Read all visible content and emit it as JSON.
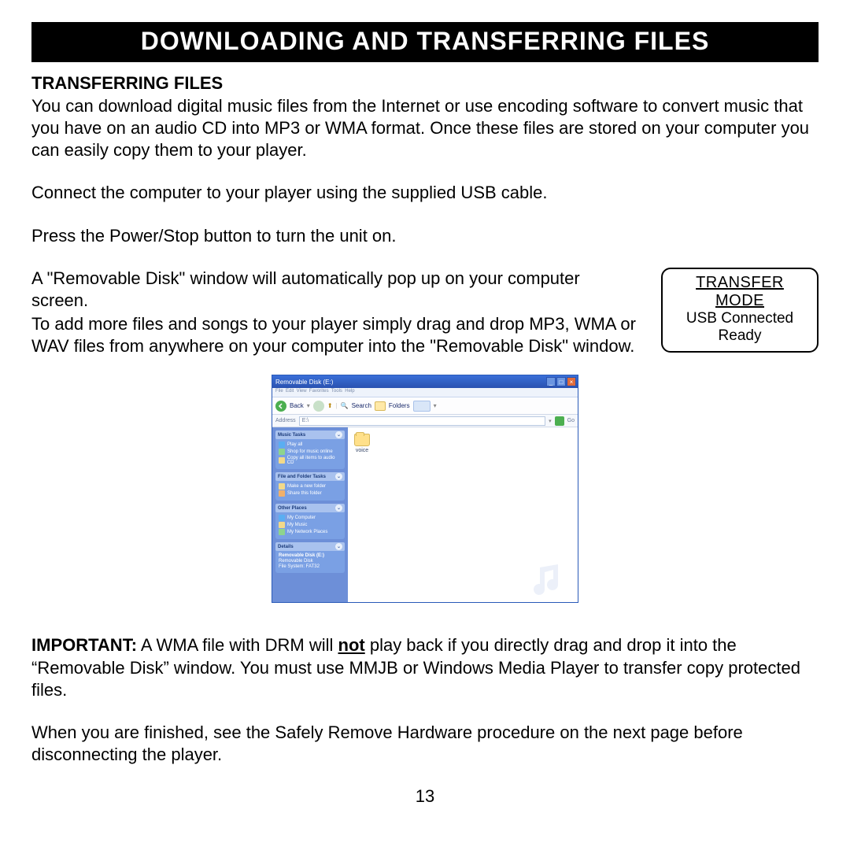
{
  "title": "DOWNLOADING AND TRANSFERRING FILES",
  "subheading": "TRANSFERRING FILES",
  "intro": "You can download digital music files from the Internet or use encoding software to convert music that you have on an audio CD into MP3 or WMA format. Once these files are stored on your computer you can easily copy them to your player.",
  "connect": "Connect the computer to your player using the supplied USB cable.",
  "power": "Press the Power/Stop button to turn the unit on.",
  "popup": "A \"Removable Disk\" window will automatically pop up on your computer screen.",
  "dragndrop": "To add more files and songs to your player simply drag and drop MP3, WMA or WAV files from anywhere on your computer into the \"Removable Disk\" window.",
  "device": {
    "line1": "TRANSFER MODE",
    "line2": "USB Connected",
    "line3": "Ready"
  },
  "xp": {
    "title": "Removable Disk (E:)",
    "back": "Back",
    "search": "Search",
    "folders": "Folders",
    "address_label": "Address",
    "address_value": "E:\\",
    "go": "Go",
    "folder_name": "voice",
    "panels": {
      "tasks": {
        "header": "Music Tasks",
        "items": [
          "Play all",
          "Shop for music online",
          "Copy all items to audio CD"
        ]
      },
      "filefolder": {
        "header": "File and Folder Tasks",
        "items": [
          "Make a new folder",
          "Share this folder"
        ]
      },
      "other": {
        "header": "Other Places",
        "items": [
          "My Computer",
          "My Music",
          "My Network Places"
        ]
      },
      "details": {
        "header": "Details",
        "items": [
          "Removable Disk (E:)",
          "Removable Disk",
          "File System: FAT32"
        ]
      }
    }
  },
  "important": {
    "prefix": "IMPORTANT:",
    "lead": " A WMA file with DRM will ",
    "not": "not",
    "rest": " play back if you directly drag and drop it into the “Removable Disk” window. You must use MMJB or Windows Media Player to transfer copy protected files."
  },
  "finish": "When you are finished, see the Safely Remove Hardware procedure on the next page before disconnecting the player.",
  "page": "13"
}
